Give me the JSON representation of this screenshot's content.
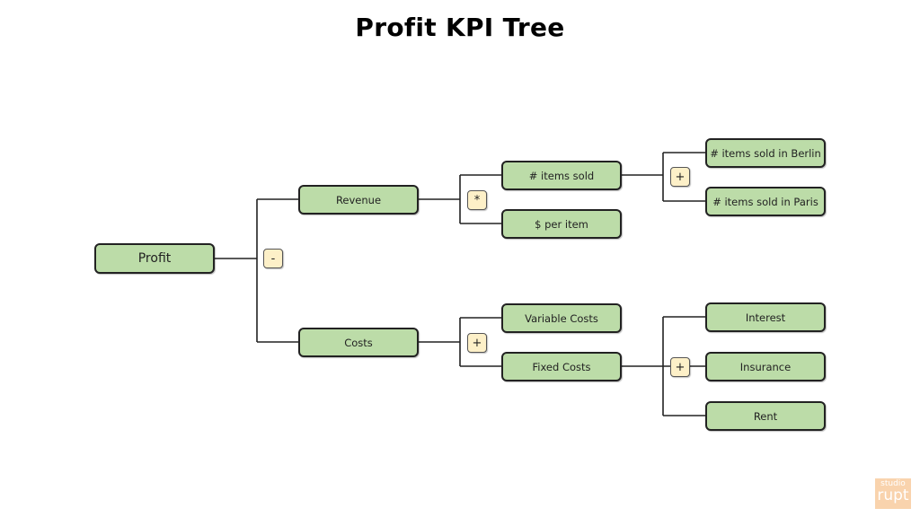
{
  "title": "Profit KPI Tree",
  "nodes": {
    "profit": "Profit",
    "revenue": "Revenue",
    "costs": "Costs",
    "items_sold": "# items sold",
    "per_item": "$ per item",
    "berlin": "# items sold in Berlin",
    "paris": "# items sold in Paris",
    "variable_costs": "Variable Costs",
    "fixed_costs": "Fixed Costs",
    "interest": "Interest",
    "insurance": "Insurance",
    "rent": "Rent"
  },
  "operators": {
    "profit": "-",
    "revenue": "*",
    "items_sold": "+",
    "costs": "+",
    "fixed_costs": "+"
  },
  "colors": {
    "node_fill": "#bcdca8",
    "operator_fill": "#fdf0c8",
    "logo": "#f9d3ad"
  },
  "logo": {
    "line1": "studio",
    "line2": "rupt"
  }
}
